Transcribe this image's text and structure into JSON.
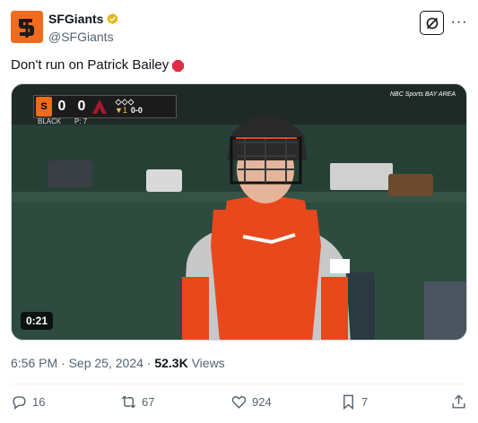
{
  "account": {
    "display_name": "SFGiants",
    "handle": "@SFGiants",
    "avatar_icon": "sf-giants-logo",
    "verified_badge": "gold-verified-badge"
  },
  "header_buttons": {
    "grok_icon": "grok-icon",
    "more_icon": "more-icon",
    "more_label": "···"
  },
  "tweet": {
    "text": "Don't run on Patrick Bailey",
    "emoji_icon": "stop-sign-emoji"
  },
  "media": {
    "duration": "0:21",
    "scorebug": {
      "home_score": "0",
      "away_score": "0",
      "home_team_label": "BLACK",
      "pitch_label": "P: 7",
      "inning": "▼1",
      "count": "0-0"
    },
    "network_label": "NBC Sports BAY AREA"
  },
  "meta": {
    "time": "6:56 PM",
    "separator": " · ",
    "date": "Sep 25, 2024",
    "views_count": "52.3K",
    "views_label": "Views"
  },
  "actions": {
    "replies": "16",
    "reposts": "67",
    "likes": "924",
    "bookmarks": "7"
  },
  "colors": {
    "brand_orange": "#f26b1d",
    "text_primary": "#0f1419",
    "text_secondary": "#536471"
  }
}
